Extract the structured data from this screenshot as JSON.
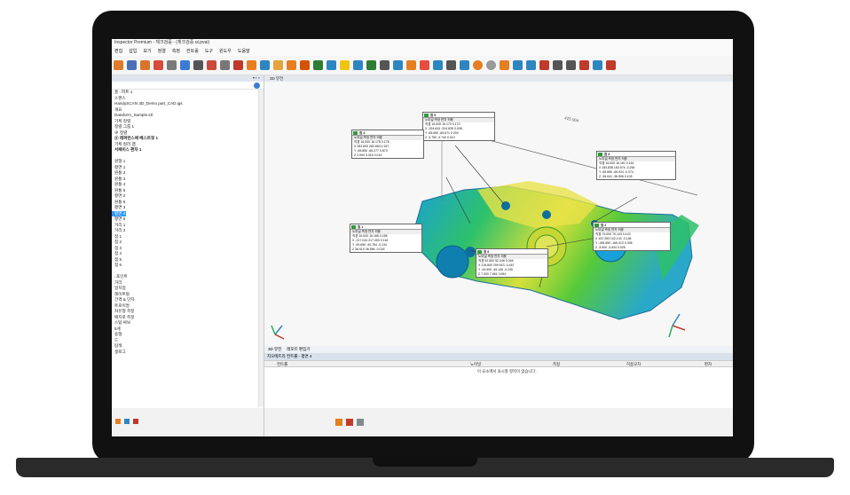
{
  "window": {
    "title": "Inspector Premium - 체크검증 - (체크검증 ut.pvai)"
  },
  "menu": [
    "편집",
    "삽입",
    "보기",
    "정렬",
    "측정",
    "컨트롤",
    "도구",
    "윈도우",
    "도움말"
  ],
  "panel": {
    "header_controls": "▾ ▪ ×",
    "tree": [
      {
        "label": "홈 : 파트 1",
        "bold": false
      },
      {
        "label": "스캔스",
        "bold": false
      },
      {
        "label": "HandySCAN 3D_Demo part_CAD.igs",
        "bold": false
      },
      {
        "label": "개요",
        "bold": false
      },
      {
        "label": "Dataform_Sample.stl",
        "bold": false
      },
      {
        "label": "기획 정렬",
        "bold": false
      },
      {
        "label": "정렬 그룹 1",
        "bold": false
      },
      {
        "label": "⊕ 정렬",
        "bold": false
      },
      {
        "label": "ⓐ 레퍼런스에 베스트핏 1",
        "bold": true
      },
      {
        "label": "기획 컬러 맵",
        "bold": false
      },
      {
        "label": "서페이스 편차 1",
        "bold": true
      },
      {
        "label": "",
        "bold": false
      },
      {
        "label": "원형 1",
        "bold": false
      },
      {
        "label": "평면 1",
        "bold": false
      },
      {
        "label": "원통 2",
        "bold": false
      },
      {
        "label": "원통 3",
        "bold": false
      },
      {
        "label": "원통 4",
        "bold": false
      },
      {
        "label": "원통 5",
        "bold": false
      },
      {
        "label": "평면 2",
        "bold": false
      },
      {
        "label": "원통 6",
        "bold": false
      },
      {
        "label": "평면 3",
        "bold": false
      },
      {
        "label": "평면 4",
        "bold": false,
        "selected": true
      },
      {
        "label": "평면 5",
        "bold": false
      },
      {
        "label": "거리 1",
        "bold": false
      },
      {
        "label": "거리 2",
        "bold": false
      },
      {
        "label": "점 1",
        "bold": false
      },
      {
        "label": "점 2",
        "bold": false
      },
      {
        "label": "점 3",
        "bold": false
      },
      {
        "label": "점 4",
        "bold": false
      },
      {
        "label": "점 5",
        "bold": false
      },
      {
        "label": "점 6",
        "bold": false
      },
      {
        "label": "",
        "bold": false
      },
      {
        "label": "ᵢ 포인트",
        "bold": false
      },
      {
        "label": "거리",
        "bold": false
      },
      {
        "label": "일치점",
        "bold": false
      },
      {
        "label": "레이트럴",
        "bold": false
      },
      {
        "label": "간격 & 단차",
        "bold": false
      },
      {
        "label": "트로이얼",
        "bold": false
      },
      {
        "label": "자유형 측정",
        "bold": false
      },
      {
        "label": "에지로 측정",
        "bold": false
      },
      {
        "label": "스탑 싸보",
        "bold": false
      },
      {
        "label": "5게",
        "bold": false
      },
      {
        "label": "용형",
        "bold": false
      },
      {
        "label": "드",
        "bold": false
      },
      {
        "label": "탐색",
        "bold": false
      },
      {
        "label": "생로그",
        "bold": false
      }
    ]
  },
  "view": {
    "tab": "3D 뷰전",
    "dimension_label": "415.004",
    "callouts": [
      {
        "title": "원 5",
        "cols": "        노미널    측정    편차 허용",
        "rows": [
          "직경   16.000  16.170  0.170",
          "X  -204.643 -204.635  0.008",
          "Y   -65.650  -65.671  0.200",
          "Z    -3.750   -3.740  0.010"
        ]
      },
      {
        "title": "원 4",
        "cols": "        노미널    측정    편차 허용",
        "rows": [
          "직경   16.000  16.178  0.178",
          "X   282.600 282.663  0.157",
          "Y   -65.850  -66.277  0.873",
          "Z     2.994   3.015  0.013"
        ]
      },
      {
        "title": "원 3",
        "cols": "        노미널    측정    편차 허용",
        "rows": [
          "직경   16.000  16.161  0.161",
          "X   183.838 183.574 -0.264",
          "Y   -65.650  -65.924 -0.074",
          "Z   -36.641  -36.596  0.105"
        ]
      },
      {
        "title": "원 1",
        "cols": "        노미널    측정    편차 허용",
        "rows": [
          "직경   16.000  16.185  0.185",
          "X  -217.044 217.400  0.116",
          "Y   -90.650  -90.784 -0.134",
          "Z    36.610  36.556 -0.018"
        ]
      },
      {
        "title": "원 2",
        "cols": "        노미널    측정    편차 허용",
        "rows": [
          "직경   79.000  79.143  0.143",
          "X   102.353 102.143 -0.146",
          "Y  -165.650 -165.413  0.035",
          "Z    -3.600   -3.534  0.025"
        ]
      },
      {
        "title": "원 6",
        "cols": "        노미널    측정    편차 허용",
        "rows": [
          "직경   52.800  52.046  0.046",
          "X   216.800 299.913 -0.467",
          "Y   -44.900  -45.145 -0.245",
          "Z     7.300    7.651  0.651"
        ]
      }
    ]
  },
  "bottom_tabs": [
    "3D 뷰전",
    "레포트 편집기"
  ],
  "table": {
    "title": "지오메트리 컨트롤 - 평면 4",
    "columns": [
      "컨트롤",
      "노미널",
      "측정",
      "허용오차",
      "편차"
    ],
    "empty_message": "이 요소에서 표시할 항목이 없습니다."
  },
  "colors": {
    "accent": "#3399ff",
    "screen_bg": "#f3f3f3"
  }
}
